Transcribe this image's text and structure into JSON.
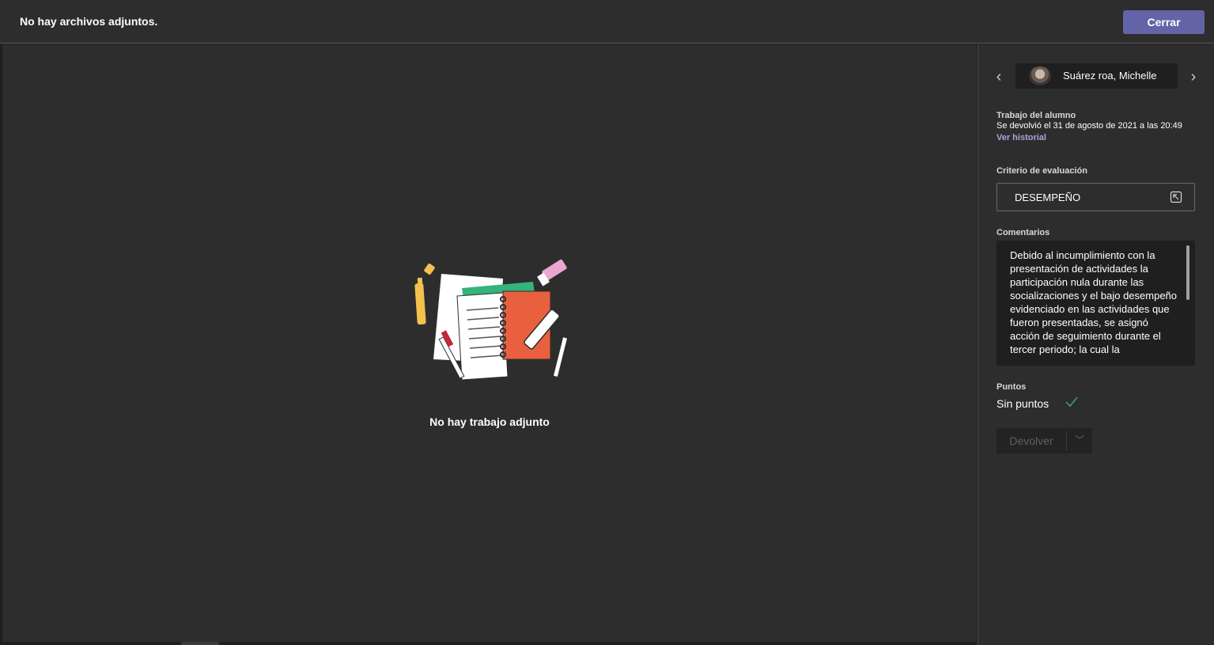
{
  "header": {
    "title": "No hay archivos adjuntos.",
    "close_label": "Cerrar"
  },
  "main": {
    "empty_message": "No hay trabajo adjunto",
    "illustration_icon": "notebook-illustration"
  },
  "side": {
    "student_name": "Suárez roa, Michelle",
    "work_label": "Trabajo del alumno",
    "returned_text": "Se devolvió el 31 de agosto de 2021 a las 20:49",
    "history_link": "Ver historial",
    "rubric_label": "Criterio de evaluación",
    "rubric_value": "DESEMPEÑO",
    "comments_label": "Comentarios",
    "comment_text": "Debido al incumplimiento con la presentación de actividades la participación nula durante las socializaciones y el bajo desempeño evidenciado en las actividades que fueron presentadas, se asignó acción de seguimiento durante el tercer periodo; la cual la",
    "points_label": "Puntos",
    "points_value": "Sin puntos",
    "return_label": "Devolver"
  },
  "colors": {
    "accent": "#6264a7",
    "link": "#a6a7dc",
    "check": "#41a56b",
    "background": "#2d2d2d"
  }
}
